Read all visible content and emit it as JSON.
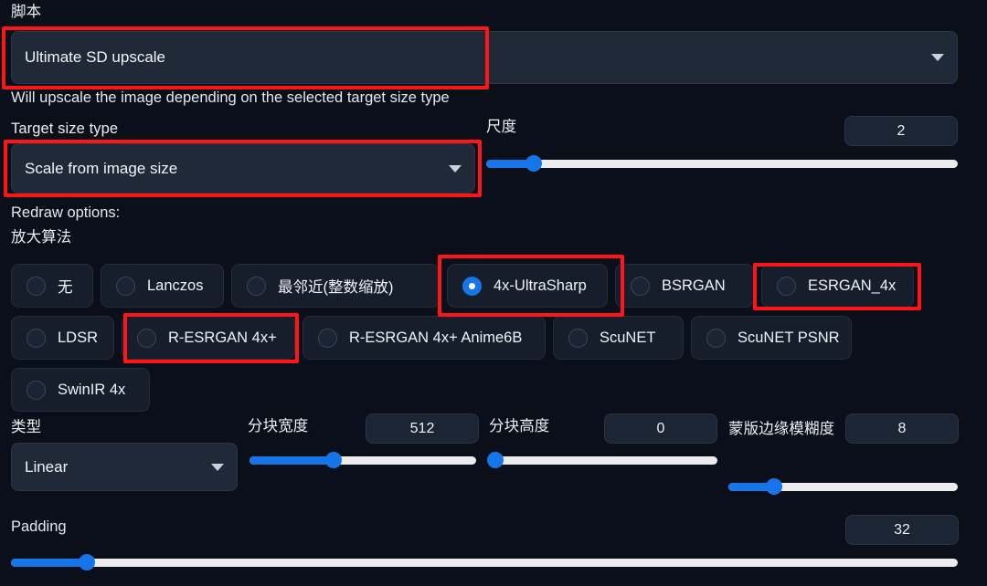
{
  "script_section": {
    "label": "脚本",
    "value": "Ultimate SD upscale",
    "description": "Will upscale the image depending on the selected target size type"
  },
  "target_size": {
    "label": "Target size type",
    "value": "Scale from image size"
  },
  "scale": {
    "label": "尺度",
    "value": "2",
    "percent": 10
  },
  "redraw": {
    "label": "Redraw options:",
    "upscaler_label": "放大算法",
    "options": [
      {
        "label": "无",
        "checked": false
      },
      {
        "label": "Lanczos",
        "checked": false
      },
      {
        "label": "最邻近(整数缩放)",
        "checked": false
      },
      {
        "label": "4x-UltraSharp",
        "checked": true
      },
      {
        "label": "BSRGAN",
        "checked": false
      },
      {
        "label": "ESRGAN_4x",
        "checked": false
      },
      {
        "label": "LDSR",
        "checked": false
      },
      {
        "label": "R-ESRGAN 4x+",
        "checked": false
      },
      {
        "label": "R-ESRGAN 4x+ Anime6B",
        "checked": false
      },
      {
        "label": "ScuNET",
        "checked": false
      },
      {
        "label": "ScuNET PSNR",
        "checked": false
      },
      {
        "label": "SwinIR 4x",
        "checked": false
      }
    ]
  },
  "type_select": {
    "label": "类型",
    "value": "Linear"
  },
  "tile_width": {
    "label": "分块宽度",
    "value": "512",
    "percent": 37
  },
  "tile_height": {
    "label": "分块高度",
    "value": "0",
    "percent": 2
  },
  "mask_blur": {
    "label": "蒙版边缘模糊度",
    "value": "8",
    "percent": 20
  },
  "padding": {
    "label": "Padding",
    "value": "32",
    "percent": 8
  },
  "colors": {
    "accent": "#1775ea",
    "highlight": "#ff1418",
    "background": "#0b0f19",
    "panel": "#1f2937"
  }
}
